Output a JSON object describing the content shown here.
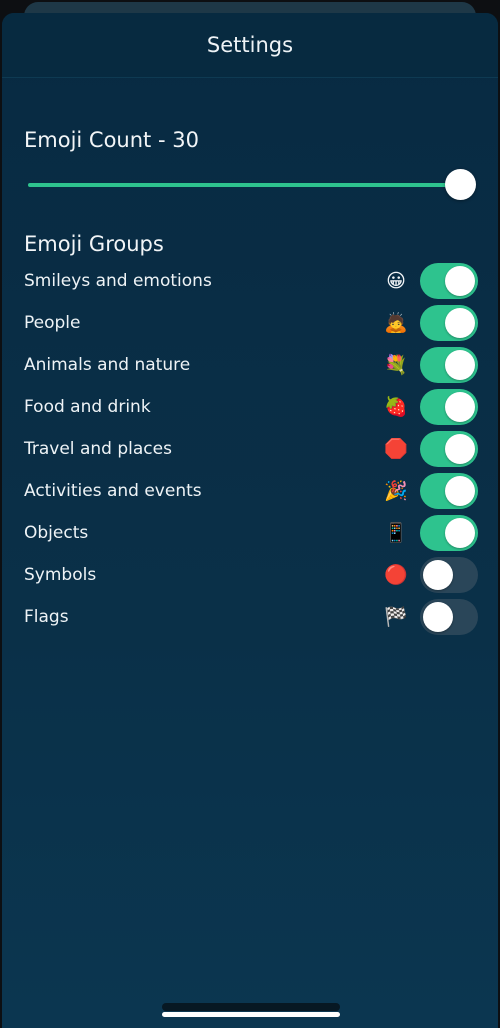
{
  "header": {
    "title": "Settings"
  },
  "emoji_count": {
    "label": "Emoji Count - 30",
    "value": 30,
    "slider_fill_fraction": 1.0
  },
  "groups": {
    "title": "Emoji Groups",
    "items": [
      {
        "label": "Smileys and emotions",
        "emoji": "😀",
        "icon": "grinning-face-icon",
        "enabled": true
      },
      {
        "label": "People",
        "emoji": "🙇",
        "icon": "person-bowing-icon",
        "enabled": true
      },
      {
        "label": "Animals and nature",
        "emoji": "💐",
        "icon": "bouquet-icon",
        "enabled": true
      },
      {
        "label": "Food and drink",
        "emoji": "🍓",
        "icon": "strawberry-icon",
        "enabled": true
      },
      {
        "label": "Travel and places",
        "emoji": "🛑",
        "icon": "stop-sign-icon",
        "enabled": true
      },
      {
        "label": "Activities and events",
        "emoji": "🎉",
        "icon": "party-popper-icon",
        "enabled": true
      },
      {
        "label": "Objects",
        "emoji": "📱",
        "icon": "mobile-phone-icon",
        "enabled": true
      },
      {
        "label": "Symbols",
        "emoji": "🔴",
        "icon": "red-circle-icon",
        "enabled": false
      },
      {
        "label": "Flags",
        "emoji": "🏁",
        "icon": "chequered-flag-icon",
        "enabled": false
      }
    ]
  },
  "colors": {
    "accent": "#2ec38e",
    "toggle_off": "#2a4659",
    "background": "#082a42"
  }
}
